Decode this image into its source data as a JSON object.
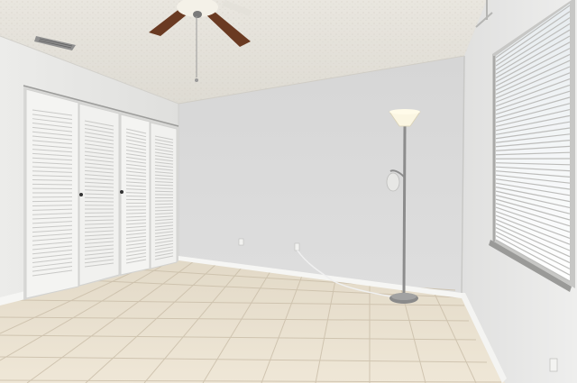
{
  "scene": {
    "subject": "empty-bedroom",
    "colors": {
      "ceiling": "#e6e3dc",
      "back_wall": "#dcdcdc",
      "left_wall": "#e4e4e2",
      "right_wall": "#e9e9e8",
      "tile": "#e9e0cf",
      "grout": "#c9bfae",
      "baseboard": "#f6f6f4",
      "closet_door": "#f4f4f2",
      "fan_blade": "#6a3a22",
      "lamp_pole": "#8c8c8c",
      "lamp_shade": "#fbf6e2",
      "blinds": "#f1f1ef",
      "window_light": "#ffffff"
    },
    "objects": [
      "ceiling-fan",
      "air-vent",
      "bifold-closet-doors",
      "floor-lamp",
      "window-blinds",
      "wall-outlet",
      "tile-floor"
    ]
  }
}
